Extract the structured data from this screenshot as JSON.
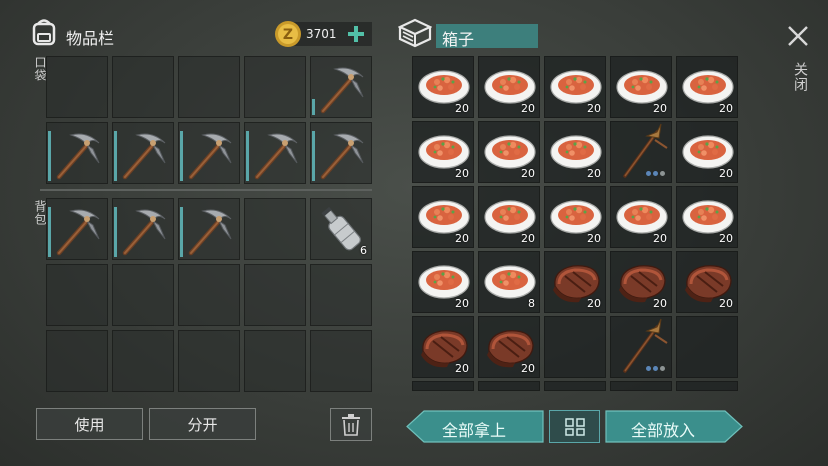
{
  "inventory": {
    "title": "物品栏",
    "currency": "3701",
    "pocket_label": "口袋",
    "backpack_label": "背包",
    "pocket_slots": [
      {
        "item": "empty"
      },
      {
        "item": "empty"
      },
      {
        "item": "empty"
      },
      {
        "item": "empty"
      },
      {
        "item": "pickaxe-icon",
        "bar": "short"
      },
      {
        "item": "pickaxe-icon",
        "bar": "full"
      },
      {
        "item": "pickaxe-icon",
        "bar": "full"
      },
      {
        "item": "pickaxe-icon",
        "bar": "full"
      },
      {
        "item": "pickaxe-icon",
        "bar": "full"
      },
      {
        "item": "pickaxe-icon",
        "bar": "full"
      }
    ],
    "backpack_slots": [
      {
        "item": "pickaxe-icon",
        "bar": "full"
      },
      {
        "item": "pickaxe-icon",
        "bar": "full"
      },
      {
        "item": "pickaxe-icon",
        "bar": "full"
      },
      {
        "item": "empty"
      },
      {
        "item": "water-bottle-icon",
        "count": "6"
      },
      {
        "item": "empty"
      },
      {
        "item": "empty"
      },
      {
        "item": "empty"
      },
      {
        "item": "empty"
      },
      {
        "item": "empty"
      },
      {
        "item": "empty"
      },
      {
        "item": "empty"
      },
      {
        "item": "empty"
      },
      {
        "item": "empty"
      },
      {
        "item": "empty"
      }
    ],
    "use_label": "使用",
    "split_label": "分开"
  },
  "box": {
    "title": "箱子",
    "slots": [
      {
        "item": "stew-plate-icon",
        "count": "20"
      },
      {
        "item": "stew-plate-icon",
        "count": "20"
      },
      {
        "item": "stew-plate-icon",
        "count": "20"
      },
      {
        "item": "stew-plate-icon",
        "count": "20"
      },
      {
        "item": "stew-plate-icon",
        "count": "20"
      },
      {
        "item": "stew-plate-icon",
        "count": "20"
      },
      {
        "item": "stew-plate-icon",
        "count": "20"
      },
      {
        "item": "stew-plate-icon",
        "count": "20"
      },
      {
        "item": "spear-pickaxe-icon",
        "dots": true
      },
      {
        "item": "stew-plate-icon",
        "count": "20"
      },
      {
        "item": "stew-plate-icon",
        "count": "20"
      },
      {
        "item": "stew-plate-icon",
        "count": "20"
      },
      {
        "item": "stew-plate-icon",
        "count": "20"
      },
      {
        "item": "stew-plate-icon",
        "count": "20"
      },
      {
        "item": "stew-plate-icon",
        "count": "20"
      },
      {
        "item": "stew-plate-icon",
        "count": "20"
      },
      {
        "item": "stew-plate-icon",
        "count": "8"
      },
      {
        "item": "meat-steak-icon",
        "count": "20"
      },
      {
        "item": "meat-steak-icon",
        "count": "20"
      },
      {
        "item": "meat-steak-icon",
        "count": "20"
      },
      {
        "item": "meat-steak-icon",
        "count": "20"
      },
      {
        "item": "meat-steak-icon",
        "count": "20"
      },
      {
        "item": "empty"
      },
      {
        "item": "spear-pickaxe-icon",
        "dots": true
      },
      {
        "item": "empty"
      }
    ],
    "take_all_label": "全部拿上",
    "put_all_label": "全部放入"
  },
  "close_label": "关闭",
  "colors": {
    "accent": "#5aa7a9",
    "teal_button": "#3b8f8c",
    "title_field": "#3d7f7c"
  }
}
